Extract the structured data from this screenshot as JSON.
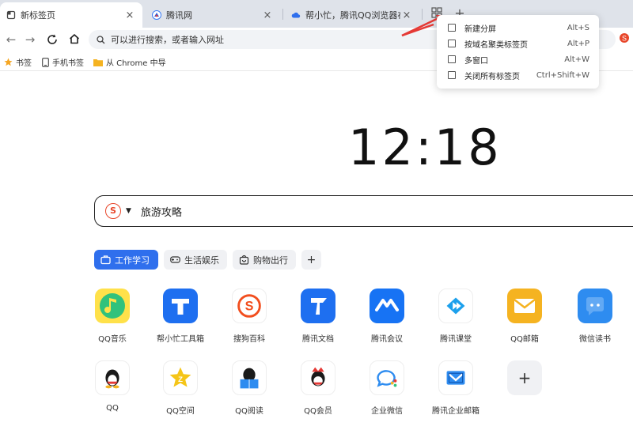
{
  "tabs": [
    {
      "title": "新标签页",
      "active": true
    },
    {
      "title": "腾讯网",
      "active": false
    },
    {
      "title": "帮小忙，腾讯QQ浏览器在线工",
      "active": false
    }
  ],
  "tab_close_glyph": "×",
  "new_tab_glyph": "+",
  "omnibox": {
    "placeholder": "可以进行搜索，或者输入网址"
  },
  "bookmarks": [
    {
      "label": "书签",
      "icon": "star-icon"
    },
    {
      "label": "手机书签",
      "icon": "phone-icon"
    },
    {
      "label": "从 Chrome 中导",
      "icon": "folder-icon"
    }
  ],
  "clock": "12:18",
  "search": {
    "engine_glyph": "S",
    "query": "旅游攻略"
  },
  "categories": [
    {
      "label": "工作学习",
      "active": true
    },
    {
      "label": "生活娱乐",
      "active": false
    },
    {
      "label": "购物出行",
      "active": false
    },
    {
      "label": "+",
      "active": false
    }
  ],
  "apps_row1": [
    {
      "label": "QQ音乐",
      "icon": "qq-music-icon",
      "color": "#ffe14a"
    },
    {
      "label": "帮小忙工具箱",
      "icon": "toolbox-icon",
      "color": "#1e6ff0"
    },
    {
      "label": "搜狗百科",
      "icon": "sogou-icon",
      "color": "#ffffff"
    },
    {
      "label": "腾讯文档",
      "icon": "tencent-docs-icon",
      "color": "#1e6ff0"
    },
    {
      "label": "腾讯会议",
      "icon": "tencent-meeting-icon",
      "color": "#1773f4"
    },
    {
      "label": "腾讯课堂",
      "icon": "tencent-classroom-icon",
      "color": "#ffffff"
    },
    {
      "label": "QQ邮箱",
      "icon": "qq-mail-icon",
      "color": "#f5b321"
    },
    {
      "label": "微信读书",
      "icon": "weread-icon",
      "color": "#2e8cf0"
    }
  ],
  "apps_row2": [
    {
      "label": "QQ",
      "icon": "qq-icon",
      "color": "#ffffff"
    },
    {
      "label": "QQ空间",
      "icon": "qzone-icon",
      "color": "#ffffff"
    },
    {
      "label": "QQ阅读",
      "icon": "qq-reading-icon",
      "color": "#ffffff"
    },
    {
      "label": "QQ会员",
      "icon": "qq-vip-icon",
      "color": "#ffffff"
    },
    {
      "label": "企业微信",
      "icon": "wecom-icon",
      "color": "#ffffff"
    },
    {
      "label": "腾讯企业邮箱",
      "icon": "exmail-icon",
      "color": "#ffffff"
    },
    {
      "label": "+",
      "icon": "add-icon",
      "color": "#f0f1f4"
    }
  ],
  "menu": [
    {
      "label": "新建分屏",
      "shortcut": "Alt+S",
      "icon": "split-screen-icon"
    },
    {
      "label": "按域名聚类标签页",
      "shortcut": "Alt+P",
      "icon": "group-tabs-icon"
    },
    {
      "label": "多窗口",
      "shortcut": "Alt+W",
      "icon": "multi-window-icon"
    },
    {
      "label": "关闭所有标签页",
      "shortcut": "Ctrl+Shift+W",
      "icon": "close-all-icon"
    }
  ],
  "colors": {
    "accent": "#2f6fed",
    "arrow": "#e53935",
    "tabstrip": "#dfe3ea"
  }
}
